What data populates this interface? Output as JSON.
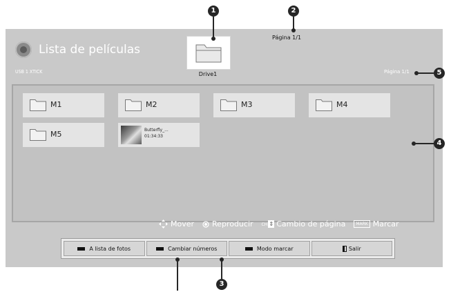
{
  "header": {
    "app_title": "Lista de películas",
    "device": "USB 1 XTICK",
    "drive_label": "Drive1",
    "page_top": "Página 1/1",
    "page_right": "Página 1/1"
  },
  "items": [
    {
      "type": "folder",
      "label": "M1"
    },
    {
      "type": "folder",
      "label": "M2"
    },
    {
      "type": "folder",
      "label": "M3"
    },
    {
      "type": "folder",
      "label": "M4"
    },
    {
      "type": "folder",
      "label": "M5"
    },
    {
      "type": "video",
      "name": "Butterfly_...",
      "duration": "01:34:33"
    }
  ],
  "legend": {
    "move": "Mover",
    "play": "Reproducir",
    "ch_key": "CH",
    "page_change": "Cambio de página",
    "mark_key": "MARK",
    "mark": "Marcar"
  },
  "buttons": {
    "photo_list": "A lista de fotos",
    "change_numbers": "Cambiar números",
    "mark_mode": "Modo marcar",
    "exit": "Salir"
  },
  "callouts": {
    "c1": "1",
    "c2": "2",
    "c3": "3",
    "c4": "4",
    "c5": "5"
  },
  "colors": {
    "screen_bg": "#c9c9c9",
    "tile_bg": "#e4e4e4",
    "callout": "#262626"
  }
}
